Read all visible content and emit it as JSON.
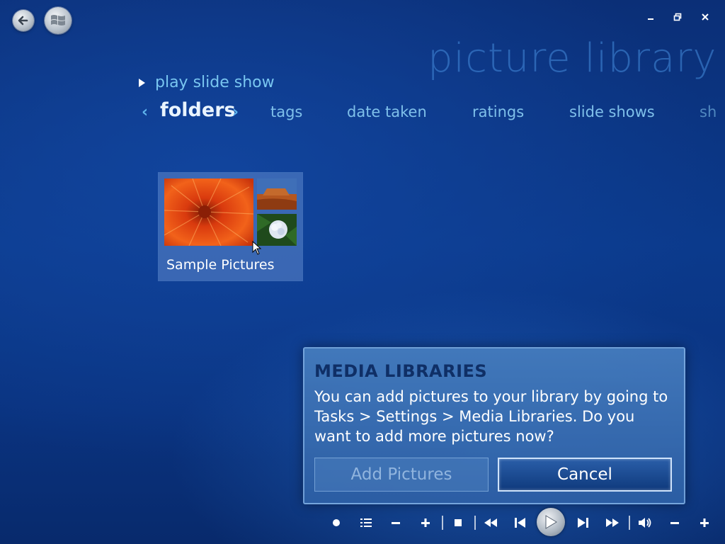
{
  "window": {
    "back_icon": "back-arrow-icon",
    "start_icon": "windows-logo-icon",
    "controls": [
      "minimize-icon",
      "restore-icon",
      "close-icon"
    ]
  },
  "page": {
    "title": "picture library"
  },
  "actions": {
    "play_slide_show": "play slide show"
  },
  "tabs": {
    "active": "folders",
    "items": [
      "tags",
      "date taken",
      "ratings",
      "slide shows",
      "sh"
    ]
  },
  "folders": [
    {
      "label": "Sample Pictures"
    }
  ],
  "dialog": {
    "title": "MEDIA LIBRARIES",
    "body": "You can add pictures to your library by going to Tasks > Settings > Media Libraries. Do you want to add more pictures now?",
    "add_button": "Add Pictures",
    "cancel_button": "Cancel"
  },
  "transport": {
    "icons": [
      "record-icon",
      "playlist-icon",
      "channel-minus-icon",
      "channel-plus-icon",
      "stop-icon",
      "rewind-icon",
      "previous-icon",
      "play-icon",
      "next-icon",
      "fast-forward-icon",
      "mute-icon",
      "volume-down-icon",
      "volume-up-icon"
    ]
  },
  "colors": {
    "background": "#0b3a8c",
    "accent": "#79c6f0",
    "dialog_title": "#0f2f66"
  }
}
